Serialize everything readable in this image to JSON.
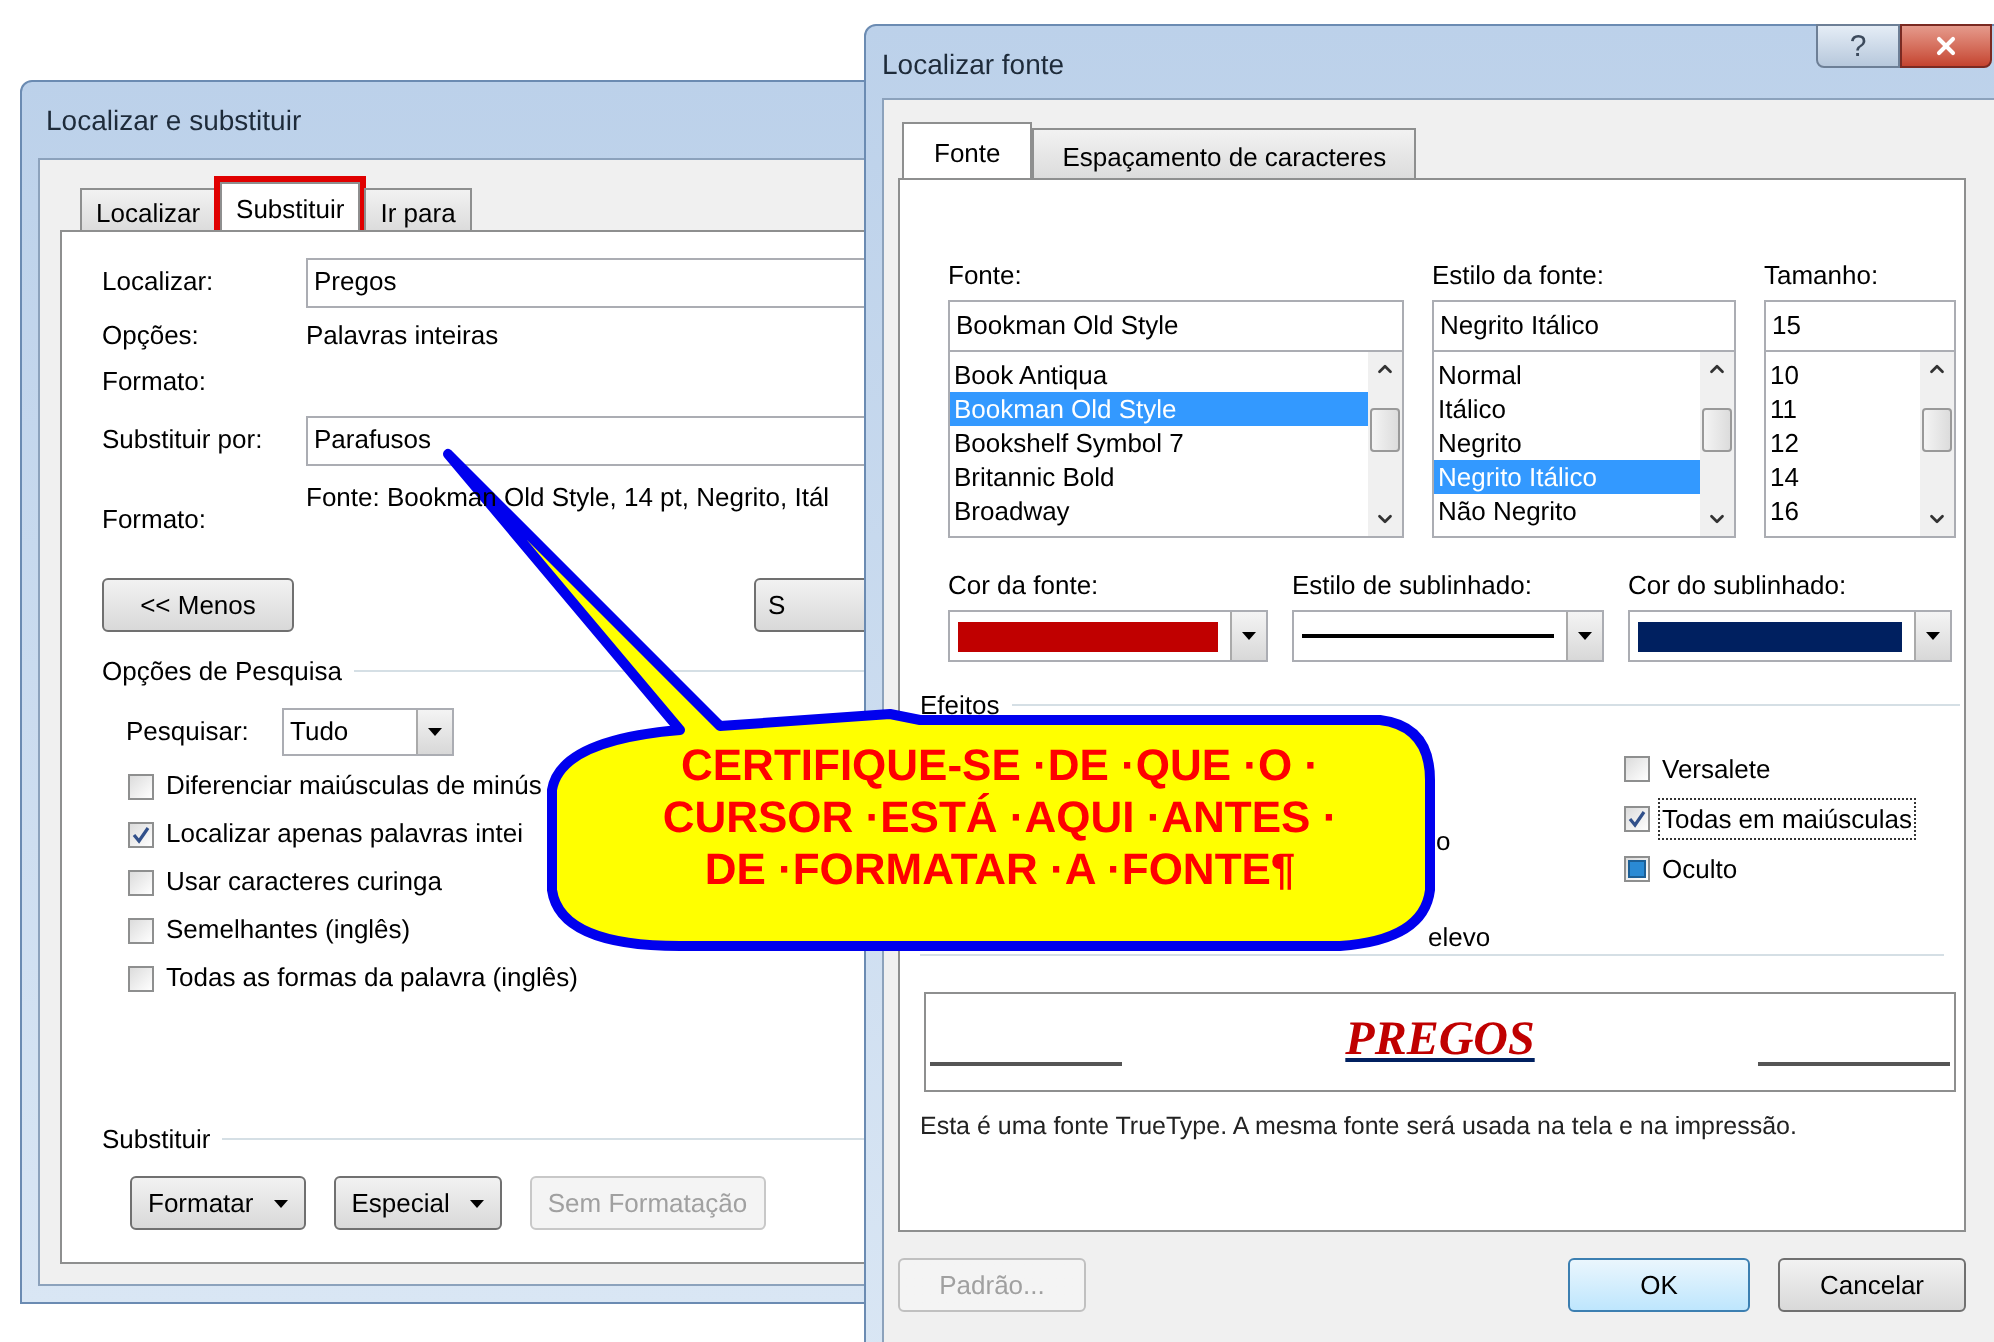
{
  "find_replace": {
    "title": "Localizar e substituir",
    "tabs": [
      {
        "label": "Localizar",
        "selected": false,
        "highlighted": false
      },
      {
        "label": "Substituir",
        "selected": true,
        "highlighted": true
      },
      {
        "label": "Ir para",
        "selected": false,
        "highlighted": false
      }
    ],
    "find_label": "Localizar:",
    "find_value": "Pregos",
    "options_label": "Opções:",
    "options_value": "Palavras inteiras",
    "find_format_label": "Formato:",
    "replace_label": "Substituir por:",
    "replace_value": "Parafusos",
    "replace_format_label": "Formato:",
    "replace_format_value": "Fonte: Bookman Old Style, 14 pt, Negrito, Itál",
    "less_button": "<< Menos",
    "cut_button": "S",
    "search_options_title": "Opções de Pesquisa",
    "search_label": "Pesquisar:",
    "search_value": "Tudo",
    "checkboxes": [
      {
        "label": "Diferenciar maiúsculas de minús",
        "checked": false
      },
      {
        "label": "Localizar apenas palavras intei",
        "checked": true
      },
      {
        "label": "Usar caracteres curinga",
        "checked": false
      },
      {
        "label": "Semelhantes (inglês)",
        "checked": false
      },
      {
        "label": "Todas as formas da palavra (inglês)",
        "checked": false
      }
    ],
    "replace_section_title": "Substituir",
    "buttons": [
      {
        "label": "Formatar",
        "dropdown": true,
        "disabled": false
      },
      {
        "label": "Especial",
        "dropdown": true,
        "disabled": false
      },
      {
        "label": "Sem Formatação",
        "dropdown": false,
        "disabled": true
      }
    ]
  },
  "find_font": {
    "title": "Localizar fonte",
    "help_button": "?",
    "tabs": [
      {
        "label": "Fonte",
        "selected": true
      },
      {
        "label": "Espaçamento de caracteres",
        "selected": false
      }
    ],
    "lists": [
      {
        "label": "Fonte:",
        "value": "Bookman Old Style",
        "items": [
          {
            "label": "Book Antiqua",
            "selected": false
          },
          {
            "label": "Bookman Old Style",
            "selected": true
          },
          {
            "label": "Bookshelf Symbol 7",
            "selected": false
          },
          {
            "label": "Britannic Bold",
            "selected": false
          },
          {
            "label": "Broadway",
            "selected": false
          }
        ]
      },
      {
        "label": "Estilo da fonte:",
        "value": "Negrito Itálico",
        "items": [
          {
            "label": "Normal",
            "selected": false
          },
          {
            "label": "Itálico",
            "selected": false
          },
          {
            "label": "Negrito",
            "selected": false
          },
          {
            "label": "Negrito Itálico",
            "selected": true
          },
          {
            "label": "Não Negrito",
            "selected": false
          }
        ]
      },
      {
        "label": "Tamanho:",
        "value": "15",
        "items": [
          {
            "label": "10",
            "selected": false
          },
          {
            "label": "11",
            "selected": false
          },
          {
            "label": "12",
            "selected": false
          },
          {
            "label": "14",
            "selected": false
          },
          {
            "label": "16",
            "selected": false
          }
        ]
      }
    ],
    "dropdowns": [
      {
        "label": "Cor da fonte:",
        "kind": "color",
        "color": "#c00000"
      },
      {
        "label": "Estilo de sublinhado:",
        "kind": "line"
      },
      {
        "label": "Cor do sublinhado:",
        "kind": "color",
        "color": "#002060"
      }
    ],
    "effects_title": "Efeitos",
    "effects_fragments": [
      "o",
      "elevo"
    ],
    "effects": [
      {
        "label": "Versalete",
        "checked": false,
        "mixed": false,
        "focused": false
      },
      {
        "label": "Todas em maiúsculas",
        "checked": true,
        "mixed": false,
        "focused": true
      },
      {
        "label": "Oculto",
        "checked": false,
        "mixed": true,
        "focused": false
      }
    ],
    "preview_text": "PREGOS",
    "note": "Esta é uma fonte TrueType. A mesma fonte será usada na tela e na impressão.",
    "buttons": [
      {
        "label": "Padrão...",
        "disabled": true,
        "default": false
      },
      {
        "label": "OK",
        "disabled": false,
        "default": true
      },
      {
        "label": "Cancelar",
        "disabled": false,
        "default": false
      }
    ]
  },
  "callout": {
    "lines": [
      "CERTIFIQUE-SE ·DE ·QUE ·O ·",
      "CURSOR ·ESTÁ ·AQUI ·ANTES ·",
      "DE ·FORMATAR ·A ·FONTE¶"
    ]
  }
}
